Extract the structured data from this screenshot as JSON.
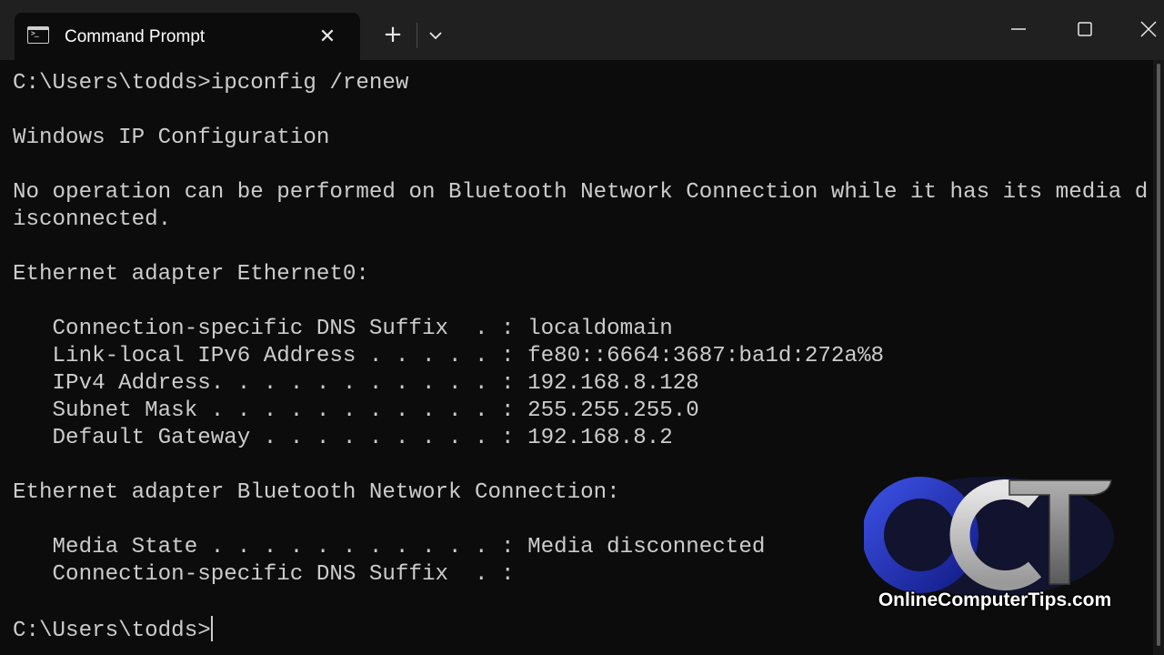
{
  "window": {
    "tab_title": "Command Prompt",
    "icons": {
      "app": "cmd-icon",
      "close_tab": "close-icon",
      "new_tab": "plus-icon",
      "dropdown": "chevron-down-icon",
      "minimize": "minimize-icon",
      "maximize": "maximize-icon",
      "close_window": "close-icon"
    },
    "glyphs": {
      "close_tab": "✕",
      "new_tab": "+"
    }
  },
  "console": {
    "lines": [
      "C:\\Users\\todds>ipconfig /renew",
      "",
      "Windows IP Configuration",
      "",
      "No operation can be performed on Bluetooth Network Connection while it has its media d",
      "isconnected.",
      "",
      "Ethernet adapter Ethernet0:",
      "",
      "   Connection-specific DNS Suffix  . : localdomain",
      "   Link-local IPv6 Address . . . . . : fe80::6664:3687:ba1d:272a%8",
      "   IPv4 Address. . . . . . . . . . . : 192.168.8.128",
      "   Subnet Mask . . . . . . . . . . . : 255.255.255.0",
      "   Default Gateway . . . . . . . . . : 192.168.8.2",
      "",
      "Ethernet adapter Bluetooth Network Connection:",
      "",
      "   Media State . . . . . . . . . . . : Media disconnected",
      "   Connection-specific DNS Suffix  . :",
      "",
      "C:\\Users\\todds>"
    ],
    "text_color": "#cccccc",
    "background": "#0c0c0c"
  },
  "logo": {
    "letters": "OCT",
    "caption": "OnlineComputerTips.com",
    "colors": {
      "o": "#1e2fbf",
      "c": "#c8c8c8",
      "t": "#8a8a8a"
    }
  }
}
